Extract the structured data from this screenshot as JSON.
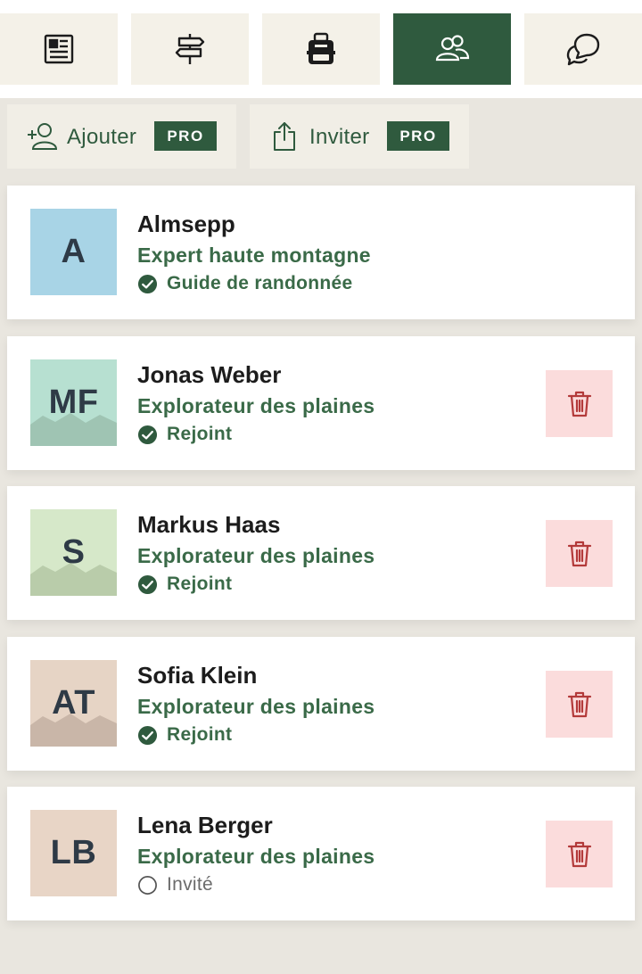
{
  "nav": {
    "tabs": [
      {
        "icon": "newspaper-icon",
        "active": false
      },
      {
        "icon": "signpost-icon",
        "active": false
      },
      {
        "icon": "backpack-icon",
        "active": false
      },
      {
        "icon": "users-icon",
        "active": true
      },
      {
        "icon": "chat-icon",
        "active": false
      }
    ]
  },
  "actions": {
    "add": {
      "label": "Ajouter",
      "badge": "PRO",
      "icon": "add-user-icon"
    },
    "invite": {
      "label": "Inviter",
      "badge": "PRO",
      "icon": "share-icon"
    }
  },
  "members": [
    {
      "initials": "A",
      "name": "Almsepp",
      "role": "Expert haute montagne",
      "status": "Guide de randonnée",
      "status_icon": "check-circle-icon",
      "avatar_color": "#a8d4e6",
      "deletable": false
    },
    {
      "initials": "MF",
      "name": "Jonas Weber",
      "role": "Explorateur des plaines",
      "status": "Rejoint",
      "status_icon": "check-circle-icon",
      "avatar_color": "#b7e0d1",
      "mountain_color": "#9fc4b3",
      "deletable": true
    },
    {
      "initials": "S",
      "name": "Markus Haas",
      "role": "Explorateur des plaines",
      "status": "Rejoint",
      "status_icon": "check-circle-icon",
      "avatar_color": "#d6e8c9",
      "mountain_color": "#b9ccaa",
      "deletable": true
    },
    {
      "initials": "AT",
      "name": "Sofia Klein",
      "role": "Explorateur des plaines",
      "status": "Rejoint",
      "status_icon": "check-circle-icon",
      "avatar_color": "#e6d4c5",
      "mountain_color": "#c9b6a8",
      "deletable": true
    },
    {
      "initials": "LB",
      "name": "Lena Berger",
      "role": "Explorateur des plaines",
      "status": "Invité",
      "status_icon": "empty-circle-icon",
      "avatar_color": "#e8d5c6",
      "deletable": true
    }
  ],
  "colors": {
    "brand_green": "#2f5a3e",
    "delete_bg": "#fbdcdc",
    "delete_icon": "#b33a3a"
  }
}
